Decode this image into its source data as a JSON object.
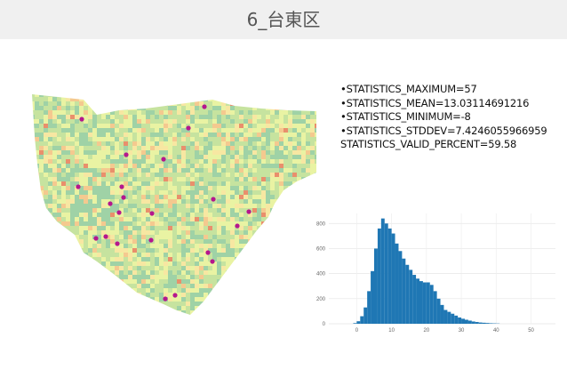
{
  "header": {
    "title": "6_台東区"
  },
  "stats": {
    "lines": [
      "•STATISTICS_MAXIMUM=57",
      "•STATISTICS_MEAN=13.03114691216",
      "•STATISTICS_MINIMUM=-8",
      "•STATISTICS_STDDEV=7.4246055966959",
      "STATISTICS_VALID_PERCENT=59.58"
    ]
  },
  "map": {
    "description_icon": "raster-heatmap-of-taito-ward",
    "colors": [
      "#9fd2a6",
      "#c6e39f",
      "#e9f3a3",
      "#f7e7a2",
      "#f4c98f",
      "#e98f6c"
    ],
    "marker_color": "#b5178d"
  },
  "chart_data": {
    "type": "bar",
    "title": "",
    "xlabel": "",
    "ylabel": "",
    "x_ticks": [
      0,
      10,
      20,
      30,
      40,
      50
    ],
    "y_ticks": [
      0,
      200,
      400,
      600,
      800
    ],
    "xlim": [
      -8,
      57
    ],
    "ylim": [
      0,
      880
    ],
    "bin_width": 1,
    "bar_color": "#1f77b4",
    "bins": [
      -1,
      0,
      1,
      2,
      3,
      4,
      5,
      6,
      7,
      8,
      9,
      10,
      11,
      12,
      13,
      14,
      15,
      16,
      17,
      18,
      19,
      20,
      21,
      22,
      23,
      24,
      25,
      26,
      27,
      28,
      29,
      30,
      31,
      32,
      33,
      34,
      35,
      36,
      37,
      38,
      39,
      40
    ],
    "values": [
      5,
      20,
      60,
      130,
      260,
      420,
      600,
      760,
      840,
      800,
      760,
      720,
      640,
      580,
      520,
      470,
      430,
      390,
      360,
      340,
      330,
      330,
      310,
      260,
      200,
      150,
      110,
      95,
      80,
      65,
      50,
      40,
      32,
      25,
      18,
      14,
      10,
      8,
      6,
      4,
      3,
      2
    ]
  }
}
